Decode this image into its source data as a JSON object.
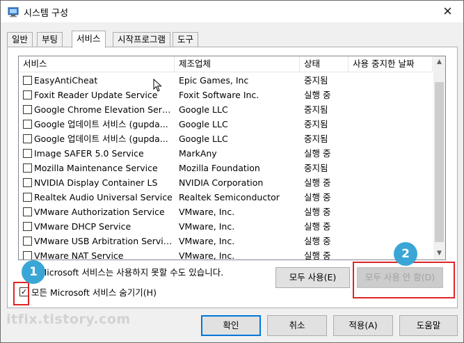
{
  "window": {
    "title": "시스템 구성",
    "close_symbol": "✕",
    "accent": "#0078d7",
    "annotation_color": "#e02424",
    "badge_color": "#3aa6d6"
  },
  "tabs": [
    {
      "label": "일반"
    },
    {
      "label": "부팅"
    },
    {
      "label": "서비스",
      "active": true
    },
    {
      "label": "시작프로그램"
    },
    {
      "label": "도구"
    }
  ],
  "services": {
    "columns": [
      "서비스",
      "제조업체",
      "상태",
      "사용 중지한 날짜"
    ],
    "rows": [
      {
        "name": "EasyAntiCheat",
        "maker": "Epic Games, Inc",
        "status": "중지됨"
      },
      {
        "name": "Foxit Reader Update Service",
        "maker": "Foxit Software Inc.",
        "status": "실행 중"
      },
      {
        "name": "Google Chrome Elevation Servic...",
        "maker": "Google LLC",
        "status": "중지됨"
      },
      {
        "name": "Google 업데이트 서비스 (gupda...",
        "maker": "Google LLC",
        "status": "중지됨"
      },
      {
        "name": "Google 업데이트 서비스 (gupda...",
        "maker": "Google LLC",
        "status": "중지됨"
      },
      {
        "name": "Image SAFER 5.0 Service",
        "maker": "MarkAny",
        "status": "실행 중"
      },
      {
        "name": "Mozilla Maintenance Service",
        "maker": "Mozilla Foundation",
        "status": "중지됨"
      },
      {
        "name": "NVIDIA Display Container LS",
        "maker": "NVIDIA Corporation",
        "status": "실행 중"
      },
      {
        "name": "Realtek Audio Universal Service",
        "maker": "Realtek Semiconductor",
        "status": "실행 중"
      },
      {
        "name": "VMware Authorization Service",
        "maker": "VMware, Inc.",
        "status": "실행 중"
      },
      {
        "name": "VMware DHCP Service",
        "maker": "VMware, Inc.",
        "status": "실행 중"
      },
      {
        "name": "VMware USB Arbitration Service",
        "maker": "VMware, Inc.",
        "status": "실행 중"
      },
      {
        "name": "VMware NAT Service",
        "maker": "VMware, Inc.",
        "status": "실행 중"
      }
    ]
  },
  "note": "안 Microsoft 서비스는 사용하지 못할 수도 있습니다.",
  "hide_ms": {
    "label": "모든 Microsoft 서비스 숨기기(H)",
    "checked": true,
    "check_symbol": "✓"
  },
  "buttons": {
    "enable_all": "모두 사용(E)",
    "disable_all": "모두 사용 안 함(D)",
    "ok": "확인",
    "cancel": "취소",
    "apply": "적용(A)",
    "help": "도움말"
  },
  "badges": {
    "one": "1",
    "two": "2"
  },
  "watermark": "itfix.tistory.com",
  "scroll": {
    "up": "▲",
    "down": "▼"
  }
}
